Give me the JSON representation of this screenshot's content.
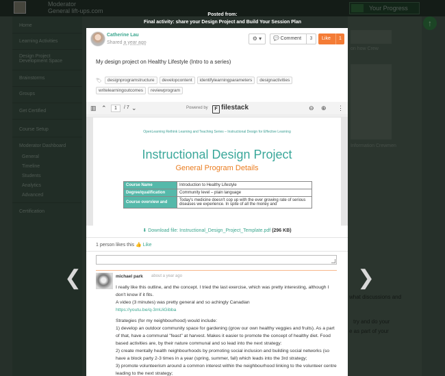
{
  "background": {
    "user_line1": "Moderator",
    "user_line2": "General lift-ups.com",
    "progress_label": "Your Progress",
    "nav": [
      {
        "label": "Home"
      },
      {
        "label": "Learning Activities"
      },
      {
        "label": "Design Project Development Space"
      },
      {
        "label": "Brainstorms"
      },
      {
        "label": "Groups"
      },
      {
        "label": "Get Certified"
      },
      {
        "label": "Course Setup"
      },
      {
        "label": "Moderator Dashboard"
      },
      {
        "label": "Certification"
      }
    ],
    "subnav": [
      "General",
      "Timeline",
      "Students",
      "Analytics",
      "Advanced"
    ],
    "right_fragment_1": "on how Crew",
    "right_fragment_2": "Information Crewmen",
    "far_right_1": "what discussions and",
    "far_right_2": "try and do your",
    "far_right_3": "e as part of your"
  },
  "lightbox": {
    "posted_from": "Posted from:",
    "activity": "Final activity: share your Design Project and Build Your Session Plan",
    "prev_glyph": "❮",
    "next_glyph": "❯"
  },
  "post": {
    "author_name": "Catherine Lau",
    "shared_prefix": "Shared",
    "shared_time": "a year ago",
    "gear_glyph": "⚙ ▾",
    "comment_label": "Comment",
    "comment_count": "3",
    "like_label": "Like",
    "like_count": "1",
    "title": "My design project on Healthy Lifestyle (Intro to a series)",
    "tag_icon": "🏷",
    "tags": [
      "designprogramstructure",
      "developcontent",
      "identifylearningparameters",
      "designactivities",
      "writelearningoutcomes",
      "reviewprogram"
    ]
  },
  "viewer": {
    "page_current": "1",
    "page_total": "/ 7",
    "powered_by": "Powered by",
    "brand": "filestack",
    "doc_series": "OpenLearning Rethink Learning and Teaching Series – Instructional Design for Effective Learning",
    "doc_title": "Instructional Design Project",
    "doc_subtitle": "General Program Details",
    "doc_rows": [
      {
        "label": "Course Name",
        "value": "Introduction to Healthy Lifestyle"
      },
      {
        "label": "Degree/qualification",
        "value": "Community level – plain language"
      },
      {
        "label": "Course overview and",
        "value": "Today's medicine doesn't cop up with the ever growing rate of serious diseases we experience. In spite of all the money and"
      }
    ],
    "download_prefix": "Download file:",
    "download_file": "Instructional_Design_Project_Template.pdf",
    "download_size": "(296 KB)"
  },
  "likes": {
    "summary": "1 person likes this",
    "like_link": "Like"
  },
  "comment": {
    "author": "michael park",
    "time": "about a year ago",
    "lines": [
      "I really like this outline, and the concept. I tried the last exercise, which was pretty interesting, although I don't know if it fits.",
      "A video (3 minutes) was pretty general and so achingly Canadian",
      "https://youtu.be/q-3mUiGibba",
      "",
      "Strategies (for my neighbourhood) would include:",
      "1) develop an outdoor community space for gardening (grow our own healthy veggies and fruits). As a part of that, have a communal \"feast\" at harvest. Makes it easier to promote the concept of healthy diet. Food based activities are, by their nature communal and so lead into the next strategy:",
      "2) create mentally health neighbourhoods by promoting social inclusion and building social networks (so have a block party 2-3 times in a year (spring, summer, fall) which leads into the 3rd strategy;",
      "3) promote volunteerism around a common interest within the neighbourhood linking to the volunteer centre leading to the next strategy;"
    ]
  }
}
